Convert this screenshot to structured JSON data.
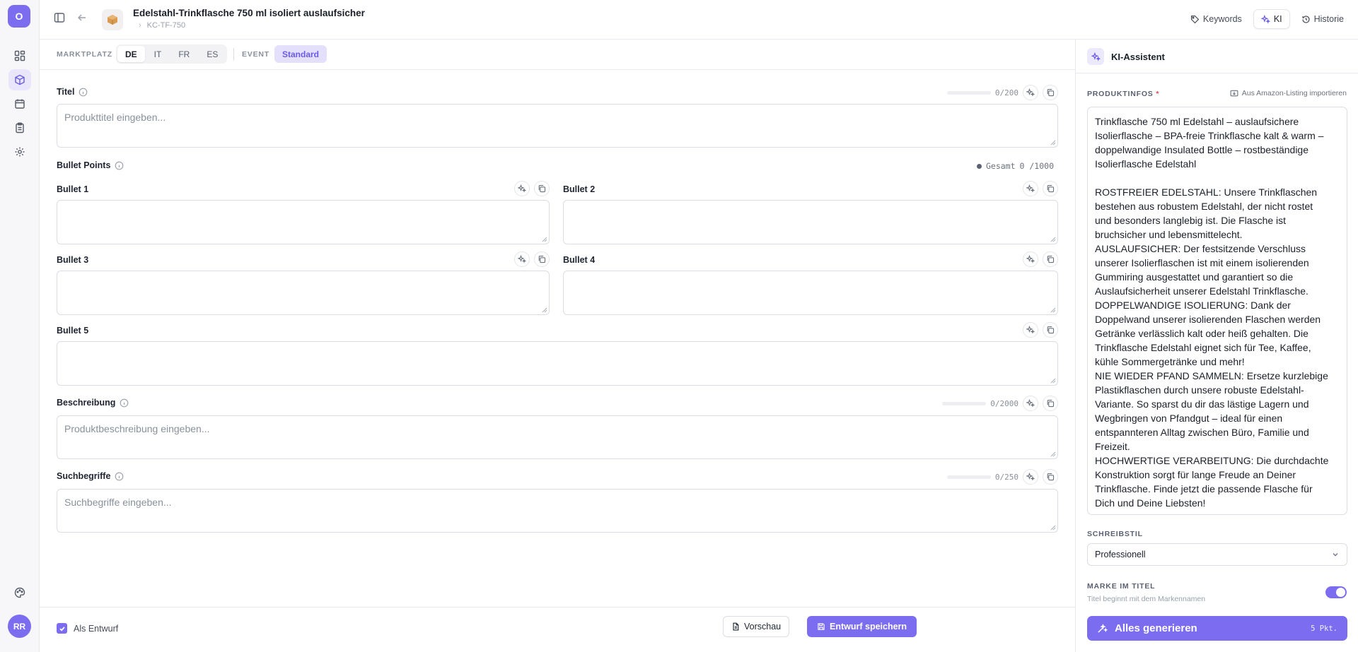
{
  "rail": {
    "logo": "O",
    "avatar": "RR",
    "items": [
      "dashboard-icon",
      "package-icon",
      "calendar-icon",
      "clipboard-icon",
      "gear-icon"
    ],
    "bottom_icon": "palette-icon"
  },
  "header": {
    "product_title": "Edelstahl-Trinkflasche 750 ml isoliert auslaufsicher",
    "sku": "KC-TF-750",
    "tabs": [
      {
        "label": "Keywords",
        "icon": "tag-icon"
      },
      {
        "label": "KI",
        "icon": "sparkles-icon",
        "active": true
      },
      {
        "label": "Historie",
        "icon": "history-icon"
      }
    ]
  },
  "marketplace": {
    "label": "MARKTPLATZ",
    "options": [
      "DE",
      "IT",
      "FR",
      "ES"
    ],
    "selected": "DE",
    "event_label": "EVENT",
    "event_value": "Standard"
  },
  "fields": {
    "title": {
      "label": "Titel",
      "placeholder": "Produkttitel eingeben...",
      "counter": "0/200"
    },
    "bullets": {
      "label": "Bullet Points",
      "total_label": "Gesamt",
      "total_counter": "0 /1000",
      "items": [
        "Bullet 1",
        "Bullet 2",
        "Bullet 3",
        "Bullet 4",
        "Bullet 5"
      ]
    },
    "description": {
      "label": "Beschreibung",
      "placeholder": "Produktbeschreibung eingeben...",
      "counter": "0/2000"
    },
    "search_terms": {
      "label": "Suchbegriffe",
      "placeholder": "Suchbegriffe eingeben...",
      "counter": "0/250"
    }
  },
  "footer": {
    "draft_checkbox": "Als Entwurf",
    "draft_checked": true,
    "preview": "Vorschau",
    "save": "Entwurf speichern"
  },
  "ai_panel": {
    "title": "KI-Assistent",
    "product_info_label": "PRODUKTINFOS",
    "required_mark": "*",
    "import_label": "Aus Amazon-Listing importieren",
    "product_info_lines": [
      "Trinkflasche 750 ml Edelstahl – auslaufsichere",
      "Isolierflasche – BPA-freie Trinkflasche kalt & warm –",
      "doppelwandige Insulated Bottle – rostbeständige",
      "Isolierflasche Edelstahl",
      "",
      "ROSTFREIER EDELSTAHL: Unsere Trinkflaschen",
      "bestehen aus robustem Edelstahl, der nicht rostet",
      "und besonders langlebig ist. Die Flasche ist",
      "bruchsicher und lebensmittelecht.",
      "AUSLAUFSICHER: Der festsitzende Verschluss",
      "unserer Isolierflaschen ist mit einem isolierenden",
      "Gummiring ausgestattet und garantiert so die",
      "Auslaufsicherheit unserer Edelstahl Trinkflasche.",
      "DOPPELWANDIGE ISOLIERUNG: Dank der",
      "Doppelwand unserer isolierenden Flaschen werden",
      "Getränke verlässlich kalt oder heiß gehalten. Die",
      "Trinkflasche Edelstahl eignet sich für Tee, Kaffee,",
      "kühle Sommergetränke und mehr!",
      "NIE WIEDER PFAND SAMMELN: Ersetze kurzlebige",
      "Plastikflaschen durch unsere robuste Edelstahl-",
      "Variante. So sparst du dir das lästige Lagern und",
      "Wegbringen von Pfandgut – ideal für einen",
      "entspannteren Alltag zwischen Büro, Familie und",
      "Freizeit.",
      "HOCHWERTIGE VERARBEITUNG: Die durchdachte",
      "Konstruktion sorgt für lange Freude an Deiner",
      "Trinkflasche. Finde jetzt die passende Flasche für",
      "Dich und Deine Liebsten!"
    ],
    "style_label": "SCHREIBSTIL",
    "style_value": "Professionell",
    "brand_label": "MARKE IM TITEL",
    "brand_sub": "Titel beginnt mit dem Markennamen",
    "brand_on": true,
    "generate": "Alles generieren",
    "generate_points": "5 Pkt."
  },
  "colors": {
    "accent": "#7b6cf0",
    "accent_soft": "#e4e0fb",
    "border": "#dcdde3"
  }
}
